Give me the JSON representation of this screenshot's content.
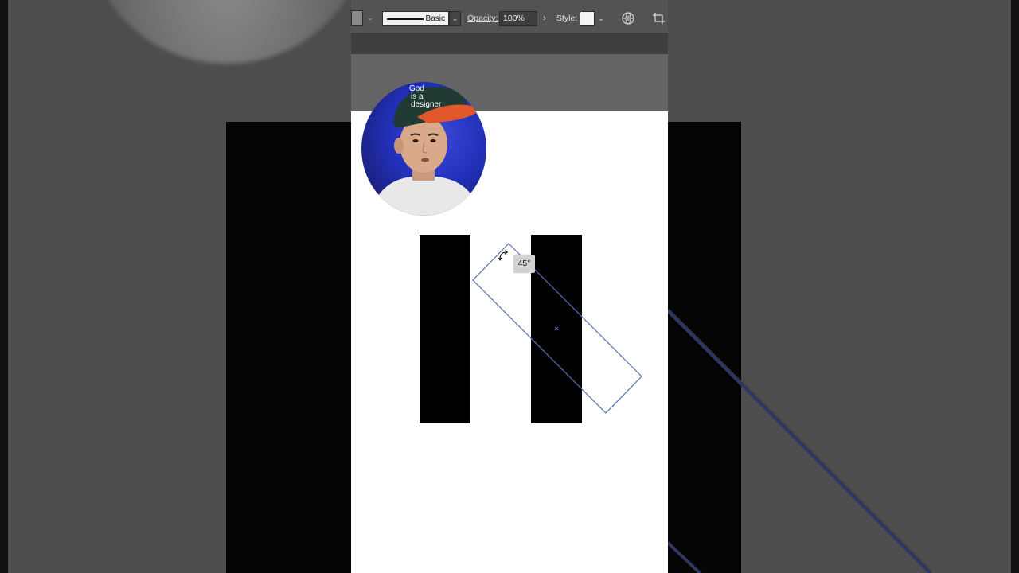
{
  "toolbar": {
    "stroke_style_label": "Basic",
    "opacity_label": "Opacity:",
    "opacity_value": "100%",
    "style_label": "Style:"
  },
  "canvas": {
    "rotation_tooltip": "45°"
  },
  "webcam": {
    "cap_text_lines": [
      "God",
      "is a",
      "designer"
    ]
  },
  "colors": {
    "toolbar_bg": "#535353",
    "artboard_bg": "#ffffff",
    "bar_fill": "#000000",
    "selection_outline": "#5a6fb8"
  },
  "icons": {
    "globe": "globe-icon",
    "crop": "crop-artboard-icon",
    "rotate_cursor": "rotate-cursor-icon"
  }
}
